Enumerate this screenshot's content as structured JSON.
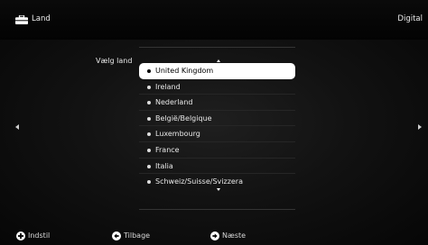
{
  "header": {
    "icon": "suitcase-icon",
    "title": "Land",
    "mode": "Digital"
  },
  "navigation": {
    "left_icon": "arrow-left-icon",
    "right_icon": "arrow-right-icon"
  },
  "country_select": {
    "label": "Vælg land",
    "scroll_up_icon": "scroll-up-icon",
    "scroll_down_icon": "scroll-down-icon",
    "items": [
      {
        "label": "United Kingdom",
        "selected": true
      },
      {
        "label": "Ireland",
        "selected": false
      },
      {
        "label": "Nederland",
        "selected": false
      },
      {
        "label": "België/Belgique",
        "selected": false
      },
      {
        "label": "Luxembourg",
        "selected": false
      },
      {
        "label": "France",
        "selected": false
      },
      {
        "label": "Italia",
        "selected": false
      },
      {
        "label": "Schweiz/Suisse/Svizzera",
        "selected": false
      }
    ]
  },
  "footer": {
    "set": {
      "label": "Indstil",
      "icon": "plus-circle-icon"
    },
    "back": {
      "label": "Tilbage",
      "icon": "left-arrow-circle-icon"
    },
    "next": {
      "label": "Næste",
      "icon": "right-arrow-circle-icon"
    }
  },
  "colors": {
    "selection": "#ffffff",
    "text": "#ffffff",
    "background": "#121212"
  }
}
